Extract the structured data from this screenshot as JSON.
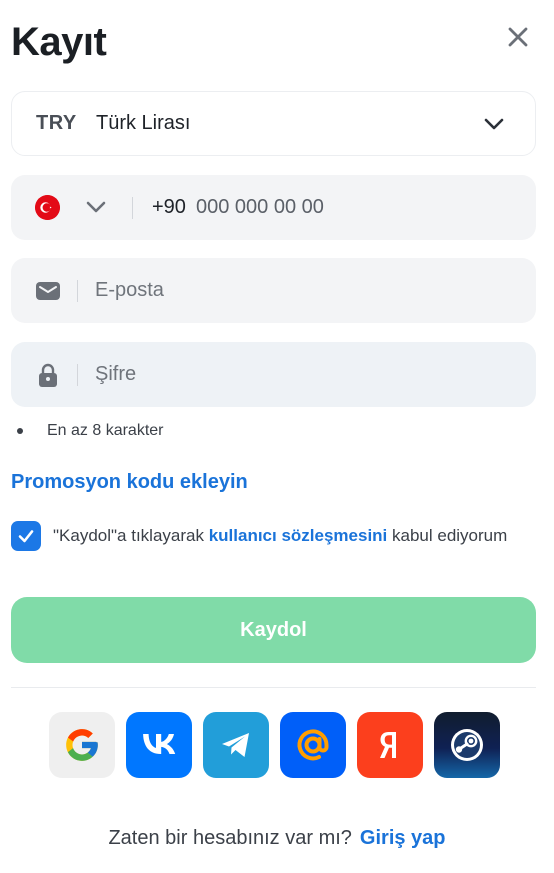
{
  "header": {
    "title": "Kayıt"
  },
  "currency": {
    "code": "TRY",
    "name": "Türk Lirası"
  },
  "phone": {
    "prefix": "+90",
    "placeholder": "000 000 00 00"
  },
  "email": {
    "placeholder": "E-posta"
  },
  "password": {
    "placeholder": "Şifre",
    "hint": "En az 8 karakter"
  },
  "promo": {
    "label": "Promosyon kodu ekleyin"
  },
  "agreement": {
    "text_before": "\"Kaydol\"a tıklayarak ",
    "link": "kullanıcı sözleşmesini",
    "text_after": " kabul ediyorum",
    "checked": true
  },
  "submit": {
    "label": "Kaydol"
  },
  "social": [
    {
      "name": "google",
      "icon": "google-icon",
      "color": "#efefef"
    },
    {
      "name": "vk",
      "icon": "vk-icon",
      "color": "#0077ff"
    },
    {
      "name": "telegram",
      "icon": "telegram-icon",
      "color": "#229ed9"
    },
    {
      "name": "mail",
      "icon": "at-icon",
      "color": "#005ff9"
    },
    {
      "name": "yandex",
      "icon": "yandex-icon",
      "color": "#fc3f1d"
    },
    {
      "name": "steam",
      "icon": "steam-icon",
      "color": "#0f2154"
    }
  ],
  "footer": {
    "question": "Zaten bir hesabınız var mı?",
    "login_link": "Giriş yap"
  },
  "colors": {
    "accent": "#1a73d9",
    "submit_bg": "#80dba8",
    "checkbox": "#1c78e6"
  }
}
